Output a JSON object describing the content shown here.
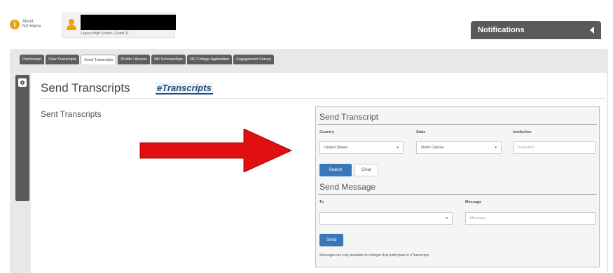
{
  "header": {
    "about_title": "About",
    "about_sub": "ND Home",
    "user_school": "Legacy High School | Grade 11"
  },
  "notifications": {
    "label": "Notifications"
  },
  "tabs": [
    {
      "label": "Dashboard",
      "active": false
    },
    {
      "label": "View Transcripts",
      "active": false
    },
    {
      "label": "Send Transcripts",
      "active": true
    },
    {
      "label": "Profile / Access",
      "active": false
    },
    {
      "label": "ND Scholarships",
      "active": false
    },
    {
      "label": "ND College Application",
      "active": false
    },
    {
      "label": "Engagement Survey",
      "active": false
    }
  ],
  "page": {
    "title": "Send Transcripts",
    "brand": "eTranscripts",
    "sent_label": "Sent Transcripts"
  },
  "send_transcript": {
    "title": "Send Transcript",
    "country_label": "Country",
    "country_value": "United States",
    "state_label": "State",
    "state_value": "North Dakota",
    "institution_label": "Institution",
    "institution_placeholder": "Institution",
    "search_label": "Search",
    "clear_label": "Clear"
  },
  "send_message": {
    "title": "Send Message",
    "to_label": "To",
    "to_value": "",
    "message_label": "Message",
    "message_placeholder": "Message",
    "send_label": "Send",
    "note": "Messages are only available to colleges that participate in eTranscripts"
  },
  "colors": {
    "accent": "#3a77b8",
    "arrow": "#e01010",
    "dark": "#5a5a5a"
  },
  "icons": {
    "info": "info-icon",
    "user": "user-icon",
    "settings": "gear-icon",
    "collapse": "chevron-left-icon"
  }
}
